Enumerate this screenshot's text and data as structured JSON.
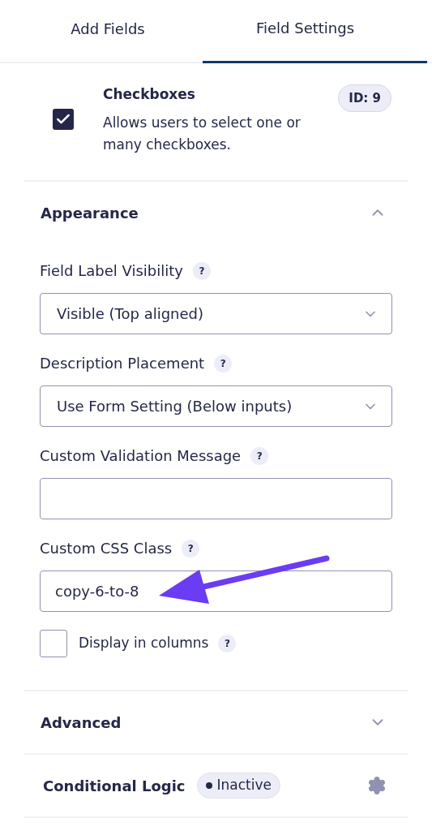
{
  "tabs": [
    {
      "label": "Add Fields",
      "selected": false
    },
    {
      "label": "Field Settings",
      "selected": true
    }
  ],
  "field": {
    "checked": true,
    "title": "Checkboxes",
    "description": "Allows users to select one or many checkboxes.",
    "id_badge": "ID: 9"
  },
  "appearance": {
    "title": "Appearance",
    "expanded": true,
    "settings": [
      {
        "kind": "select",
        "label": "Field Label Visibility",
        "help": "?",
        "value": "Visible (Top aligned)"
      },
      {
        "kind": "select",
        "label": "Description Placement",
        "help": "?",
        "value": "Use Form Setting (Below inputs)"
      },
      {
        "kind": "text",
        "label": "Custom Validation Message",
        "help": "?"
      },
      {
        "kind": "text",
        "label": "Custom CSS Class",
        "help": "?",
        "value": "copy-6-to-8"
      }
    ],
    "columns_option": {
      "label": "Display in columns",
      "help": "?",
      "checked": false
    }
  },
  "advanced": {
    "title": "Advanced",
    "expanded": false
  },
  "conditional_logic": {
    "title": "Conditional Logic",
    "status": "Inactive"
  }
}
